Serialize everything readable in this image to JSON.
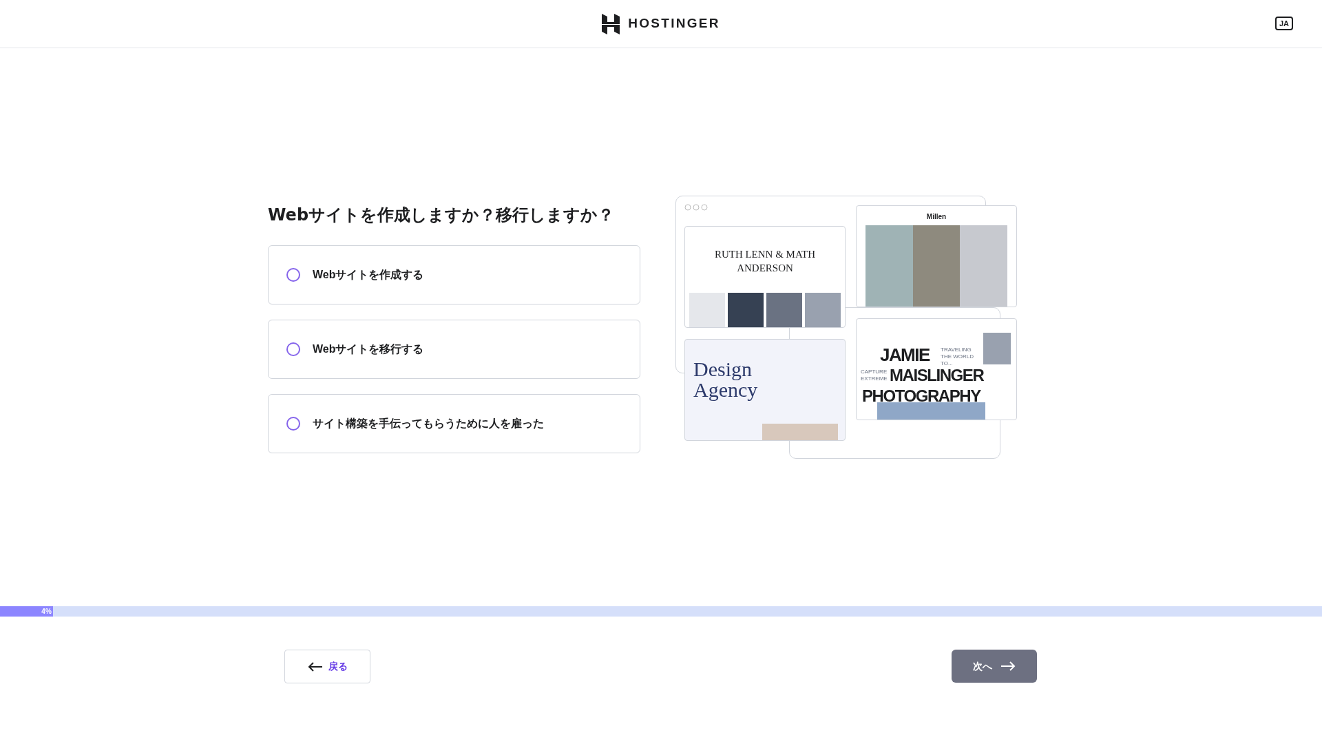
{
  "header": {
    "brand": "HOSTINGER",
    "language": "JA"
  },
  "question": "Webサイトを作成しますか？移行しますか？",
  "options": [
    {
      "label": "Webサイトを作成する",
      "selected": false
    },
    {
      "label": "Webサイトを移行する",
      "selected": false
    },
    {
      "label": "サイト構築を手伝ってもらうために人を雇った",
      "selected": false
    }
  ],
  "illustration": {
    "ruth_title": "RUTH LENN & MATH ANDERSON",
    "millen_title": "Millen",
    "design_title": "Design Agency",
    "jamie_lines": [
      "JAMIE",
      "MAISLINGER",
      "PHOTOGRAPHY"
    ],
    "jamie_tagline": "TRAVELING THE WORLD TO...",
    "jamie_side": "CAPTURE EXTREME"
  },
  "progress": {
    "level": 0.04,
    "label": "4%"
  },
  "buttons": {
    "back": "戻る",
    "next": "次へ"
  }
}
